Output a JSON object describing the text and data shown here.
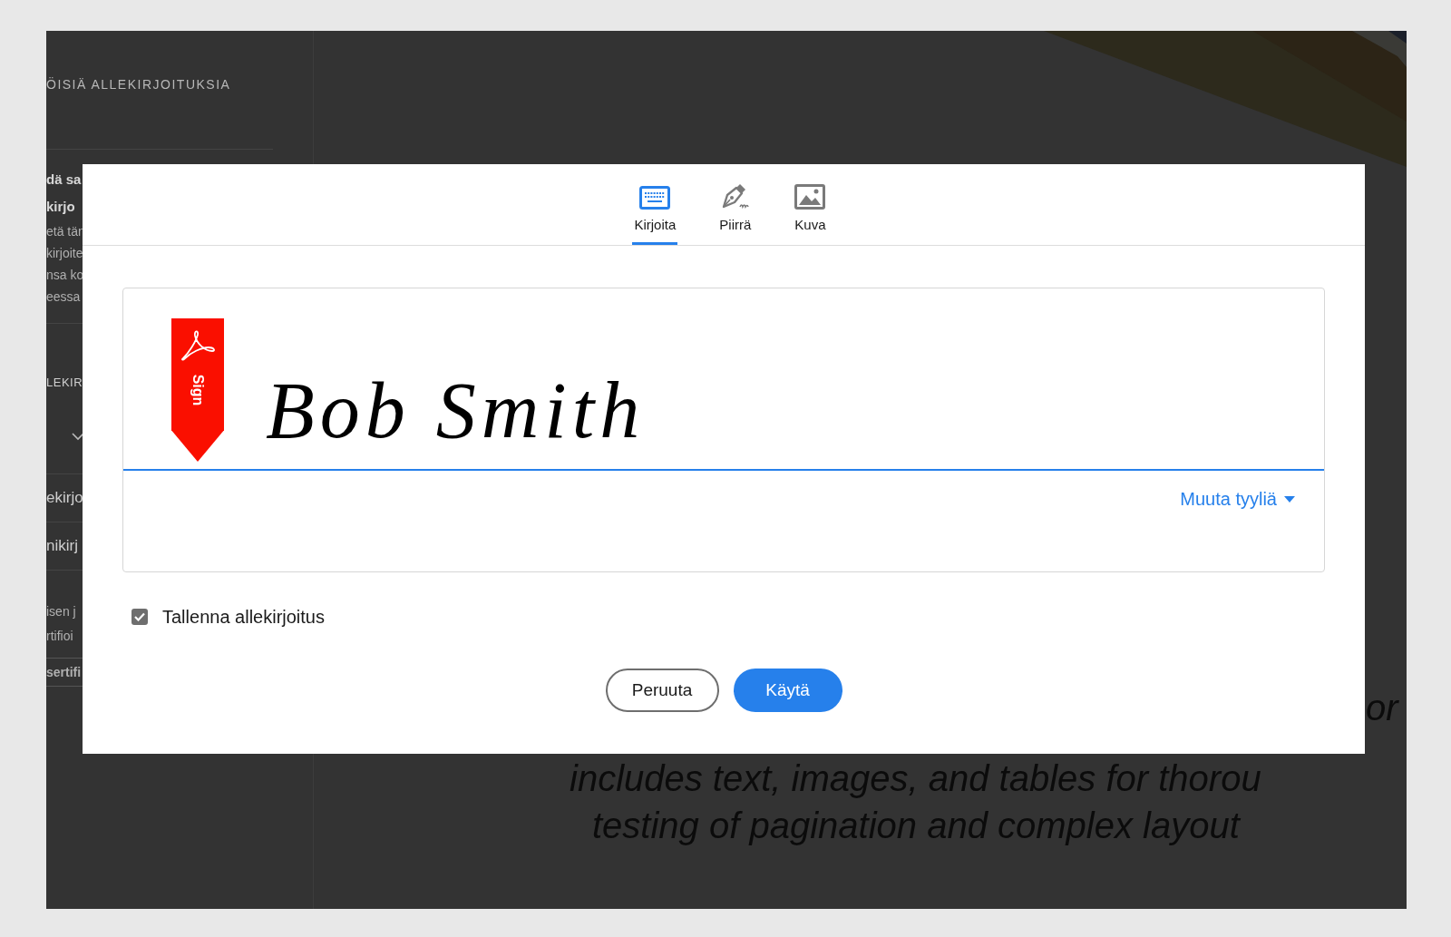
{
  "sidebar": {
    "heading": "ÖISIÄ ALLEKIRJOITUKSIA",
    "card_title": [
      "dä sa",
      "kirjo"
    ],
    "card_text": [
      "etä tän",
      "kirjoite",
      "nsa ko",
      "eessa"
    ],
    "section_label": "LEKIR",
    "items": [
      "ekirjo",
      "nikirj"
    ],
    "note": [
      "isen j",
      "rtifioi"
    ],
    "button": "sertifi"
  },
  "document": {
    "lines": [
      "or",
      "includes text, images, and tables for thorou",
      "testing of pagination and complex layout"
    ]
  },
  "dialog": {
    "tabs": [
      {
        "label": "Kirjoita",
        "kind": "type",
        "selected": true
      },
      {
        "label": "Piirrä",
        "kind": "draw",
        "selected": false
      },
      {
        "label": "Kuva",
        "kind": "image",
        "selected": false
      }
    ],
    "signature": {
      "badge": "Sign",
      "value": "Bob Smith"
    },
    "style_menu": "Muuta tyyliä",
    "save": {
      "label": "Tallenna allekirjoitus",
      "checked": true
    },
    "buttons": [
      {
        "label": "Peruuta",
        "kind": "secondary"
      },
      {
        "label": "Käytä",
        "kind": "primary"
      }
    ]
  }
}
